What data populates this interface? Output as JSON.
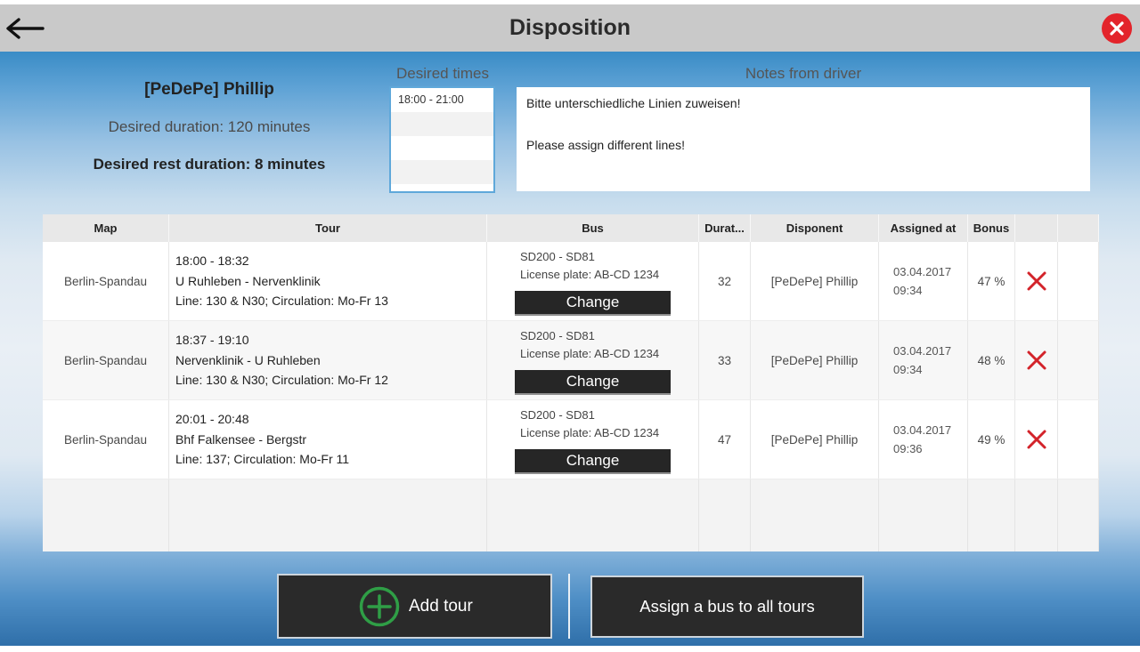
{
  "window": {
    "title": "Disposition"
  },
  "icons": {
    "back": "arrow-left-icon",
    "close": "close-icon",
    "delete_row": "delete-x-icon",
    "add_tour": "plus-circle-icon"
  },
  "colors": {
    "title_bar": "#c9c9c9",
    "close_red": "#e3242b",
    "delete_red": "#d3232a",
    "add_green": "#2f9e46",
    "button_dark": "#2a2a2a",
    "list_border": "#5fa8da",
    "background_blue": "#3a8cc6"
  },
  "driver": {
    "name": "[PeDePe] Phillip",
    "desired_duration": "Desired duration: 120 minutes",
    "desired_rest_duration": "Desired rest duration: 8 minutes"
  },
  "desired_times": {
    "label": "Desired times",
    "items": [
      "18:00 - 21:00"
    ]
  },
  "notes": {
    "label": "Notes from driver",
    "lines": [
      "Bitte unterschiedliche Linien zuweisen!",
      "Please assign different lines!"
    ]
  },
  "table": {
    "columns": {
      "map": "Map",
      "tour": "Tour",
      "bus": "Bus",
      "duration": "Durat...",
      "disponent": "Disponent",
      "assigned_at": "Assigned at",
      "bonus": "Bonus"
    },
    "rows": [
      {
        "map": "Berlin-Spandau",
        "tour": {
          "time": "18:00 - 18:32",
          "route": "U Ruhleben - Nervenklinik",
          "line": "Line: 130 & N30; Circulation: Mo-Fr 13"
        },
        "bus": {
          "name": "SD200 - SD81",
          "plate": "License plate: AB-CD 1234",
          "change_label": "Change"
        },
        "duration": "32",
        "disponent": "[PeDePe] Phillip",
        "assigned": {
          "date": "03.04.2017",
          "time": "09:34"
        },
        "bonus": "47 %"
      },
      {
        "map": "Berlin-Spandau",
        "tour": {
          "time": "18:37 - 19:10",
          "route": "Nervenklinik - U Ruhleben",
          "line": "Line: 130 & N30; Circulation: Mo-Fr 12"
        },
        "bus": {
          "name": "SD200 - SD81",
          "plate": "License plate: AB-CD 1234",
          "change_label": "Change"
        },
        "duration": "33",
        "disponent": "[PeDePe] Phillip",
        "assigned": {
          "date": "03.04.2017",
          "time": "09:34"
        },
        "bonus": "48 %"
      },
      {
        "map": "Berlin-Spandau",
        "tour": {
          "time": "20:01 - 20:48",
          "route": "Bhf Falkensee - Bergstr",
          "line": "Line: 137; Circulation: Mo-Fr 11"
        },
        "bus": {
          "name": "SD200 - SD81",
          "plate": "License plate: AB-CD 1234",
          "change_label": "Change"
        },
        "duration": "47",
        "disponent": "[PeDePe] Phillip",
        "assigned": {
          "date": "03.04.2017",
          "time": "09:36"
        },
        "bonus": "49 %"
      }
    ]
  },
  "actions": {
    "add_tour": "Add tour",
    "assign_bus_all": "Assign a bus to all tours"
  }
}
